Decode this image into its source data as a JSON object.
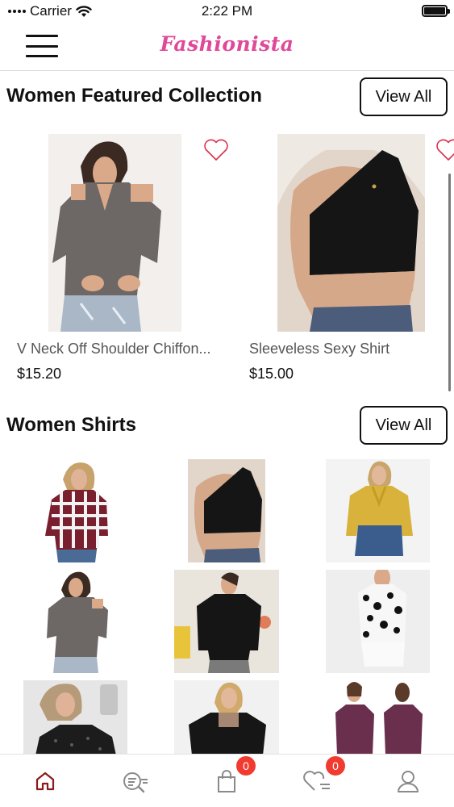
{
  "status_bar": {
    "carrier": "Carrier",
    "time": "2:22 PM"
  },
  "nav": {
    "brand": "Fashionista",
    "brand_color": "#e0489a"
  },
  "featured": {
    "title": "Women Featured Collection",
    "view_all_label": "View All",
    "products": [
      {
        "name": "V Neck Off Shoulder Chiffon...",
        "price": "$15.20",
        "image": "gray-cold-shoulder-blouse"
      },
      {
        "name": "Sleeveless Sexy Shirt",
        "price": "$15.00",
        "image": "black-one-shoulder-crop-top"
      }
    ]
  },
  "shirts": {
    "title": "Women Shirts",
    "view_all_label": "View All",
    "items": [
      {
        "image": "plaid-shirt"
      },
      {
        "image": "black-one-shoulder-crop-top"
      },
      {
        "image": "mustard-bow-blouse"
      },
      {
        "image": "gray-cold-shoulder-blouse"
      },
      {
        "image": "black-lace-top"
      },
      {
        "image": "leopard-print-shirt"
      },
      {
        "image": "black-polka-dot-top"
      },
      {
        "image": "black-sheer-blouse"
      },
      {
        "image": "purple-henley-top"
      }
    ]
  },
  "tab_bar": {
    "active_color": "#8b1a1a",
    "inactive_color": "#8a8a8a",
    "badge_color": "#f23b30",
    "tabs": [
      {
        "icon": "home-icon",
        "active": true
      },
      {
        "icon": "search-list-icon",
        "active": false
      },
      {
        "icon": "shopping-bag-icon",
        "active": false,
        "badge": "0"
      },
      {
        "icon": "wishlist-heart-icon",
        "active": false,
        "badge": "0"
      },
      {
        "icon": "user-icon",
        "active": false
      }
    ]
  }
}
